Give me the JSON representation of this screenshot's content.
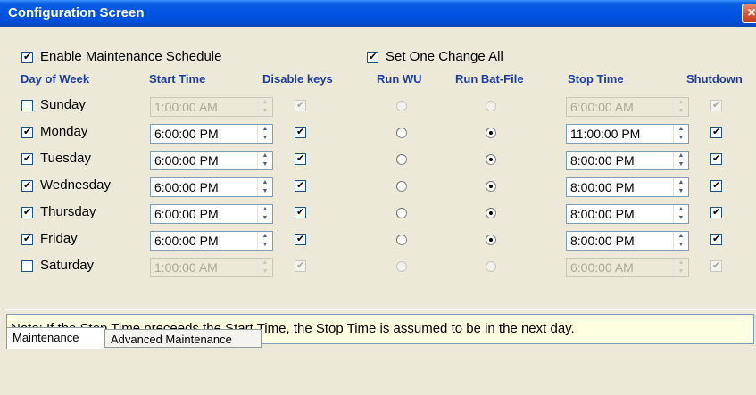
{
  "window": {
    "title": "Configuration Screen",
    "close_glyph": "×"
  },
  "options": {
    "enable_schedule": {
      "label": "Enable Maintenance Schedule",
      "checked": true
    },
    "set_one_change_all": {
      "label_pre": "Set One Change ",
      "label_accel": "A",
      "label_post": "ll",
      "checked": true
    }
  },
  "headers": {
    "day": "Day of Week",
    "start": "Start Time",
    "disable_keys": "Disable keys",
    "run_wu": "Run WU",
    "run_bat": "Run Bat-File",
    "stop": "Stop Time",
    "shutdown": "Shutdown"
  },
  "check_glyph": "✔",
  "spin_up": "▲",
  "spin_down": "▼",
  "days": [
    {
      "name": "Sunday",
      "enabled": false,
      "start": "1:00:00 AM",
      "disable_keys": true,
      "run_wu": false,
      "run_bat": false,
      "stop": "6:00:00 AM",
      "shutdown": true
    },
    {
      "name": "Monday",
      "enabled": true,
      "start": "6:00:00 PM",
      "disable_keys": true,
      "run_wu": false,
      "run_bat": true,
      "stop": "11:00:00 PM",
      "shutdown": true
    },
    {
      "name": "Tuesday",
      "enabled": true,
      "start": "6:00:00 PM",
      "disable_keys": true,
      "run_wu": false,
      "run_bat": true,
      "stop": "8:00:00 PM",
      "shutdown": true
    },
    {
      "name": "Wednesday",
      "enabled": true,
      "start": "6:00:00 PM",
      "disable_keys": true,
      "run_wu": false,
      "run_bat": true,
      "stop": "8:00:00 PM",
      "shutdown": true
    },
    {
      "name": "Thursday",
      "enabled": true,
      "start": "6:00:00 PM",
      "disable_keys": true,
      "run_wu": false,
      "run_bat": true,
      "stop": "8:00:00 PM",
      "shutdown": true
    },
    {
      "name": "Friday",
      "enabled": true,
      "start": "6:00:00 PM",
      "disable_keys": true,
      "run_wu": false,
      "run_bat": true,
      "stop": "8:00:00 PM",
      "shutdown": true
    },
    {
      "name": "Saturday",
      "enabled": false,
      "start": "1:00:00 AM",
      "disable_keys": true,
      "run_wu": false,
      "run_bat": false,
      "stop": "6:00:00 AM",
      "shutdown": true
    }
  ],
  "note": "Note: If the Stop Time preceeds the Start Time, the Stop Time is assumed to be in the next day.",
  "tabs": [
    {
      "label": "Maintenance",
      "active": true
    },
    {
      "label": "Advanced Maintenance",
      "active": false
    }
  ],
  "colors": {
    "header_text": "#1E3DA0",
    "titlebar": "#0054E3",
    "note_bg": "#FFFFE1",
    "window_bg": "#ECE9D8"
  }
}
